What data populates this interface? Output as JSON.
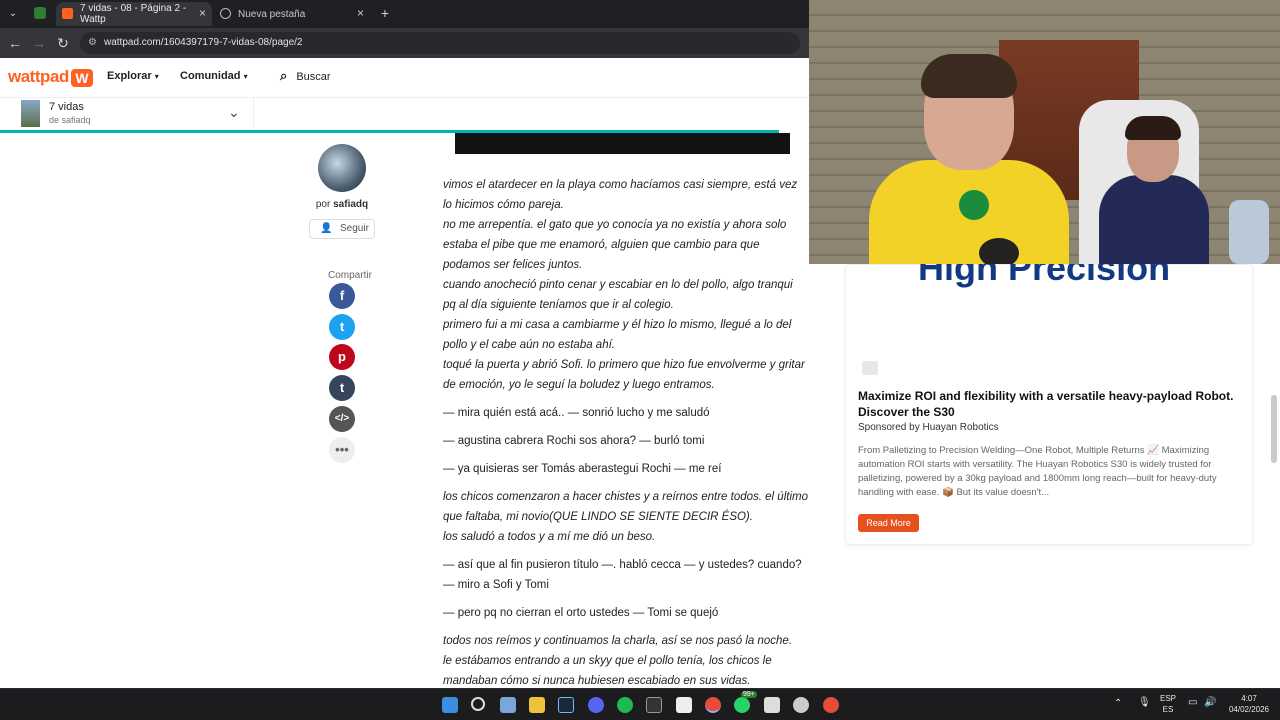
{
  "browser": {
    "tabs": [
      {
        "label": "7 vidas - 08 - Página 2 - Wattp"
      },
      {
        "label": "Nueva pestaña"
      }
    ],
    "url": "wattpad.com/1604397179-7-vidas-08/page/2"
  },
  "header": {
    "logo": "wattpad",
    "nav": [
      {
        "label": "Explorar"
      },
      {
        "label": "Comunidad"
      }
    ],
    "search_label": "Buscar"
  },
  "story_bar": {
    "title": "7 vidas",
    "author_line": "de safiadq"
  },
  "author": {
    "by_prefix": "por",
    "name": "safiadq",
    "follow_label": "Seguir",
    "share_label": "Compartir"
  },
  "story": {
    "paragraphs": [
      "vimos el atardecer en la playa como hacíamos casi siempre, está vez lo hicimos cómo pareja.",
      "no me arrepentía. el gato que yo conocía ya no existía y ahora solo estaba el pibe que me enamoró, alguien que cambio para que podamos ser felices juntos.",
      "cuando anocheció pinto cenar y escabiar en lo del pollo, algo tranqui pq al día siguiente teníamos que ir al colegio.",
      "primero fui a mi casa a cambiarme y él hizo lo mismo, llegué a lo del pollo y el cabe aún no estaba ahí.",
      "toqué la puerta y abrió Sofi. lo primero que hizo fue envolverme y gritar de emoción, yo le seguí la boludez y luego entramos.",
      "— mira quién está acá.. — sonrió lucho y me saludó",
      "— agustina cabrera Rochi sos ahora? — burló tomi",
      "— ya quisieras ser Tomás aberastegui Rochi — me reí",
      "los chicos comenzaron a hacer chistes y a reírnos entre todos. el último que faltaba, mi novio(QUE LINDO SE SIENTE DECIR ÉSO).",
      "los saludó a todos y a mí me dió un beso.",
      "— así que al fin pusieron título —. habló cecca — y ustedes? cuando? — miro a Sofi y Tomi",
      "— pero pq no cierran el orto ustedes — Tomi se quejó",
      "todos nos reímos y continuamos la charla, así se nos pasó la noche.",
      "le estábamos entrando a un skyy que el pollo tenía, los chicos le mandaban cómo si nunca hubiesen escabiado en sus vidas."
    ]
  },
  "ad": {
    "hero_text": "High Precision",
    "title": "Maximize ROI and flexibility with a versatile heavy-payload Robot. Discover the S30",
    "sponsor": "Sponsored by Huayan Robotics",
    "body": "From Palletizing to Precision Welding—One Robot, Multiple Returns 📈 Maximizing automation ROI starts with versatility. The Huayan Robotics S30 is widely trusted for palletizing, powered by a 30kg payload and 1800mm long reach—built for heavy-duty handling with ease. 📦 But its value doesn't...",
    "button": "Read More"
  },
  "taskbar": {
    "lang": "ESP",
    "lang2": "ES",
    "time": "4:07",
    "date": "04/02/2026",
    "badge": "99+"
  },
  "colors": {
    "brand": "#ff6122",
    "progress": "#00b2b2",
    "ad_button": "#e8511c",
    "ad_hero": "#123a82"
  }
}
